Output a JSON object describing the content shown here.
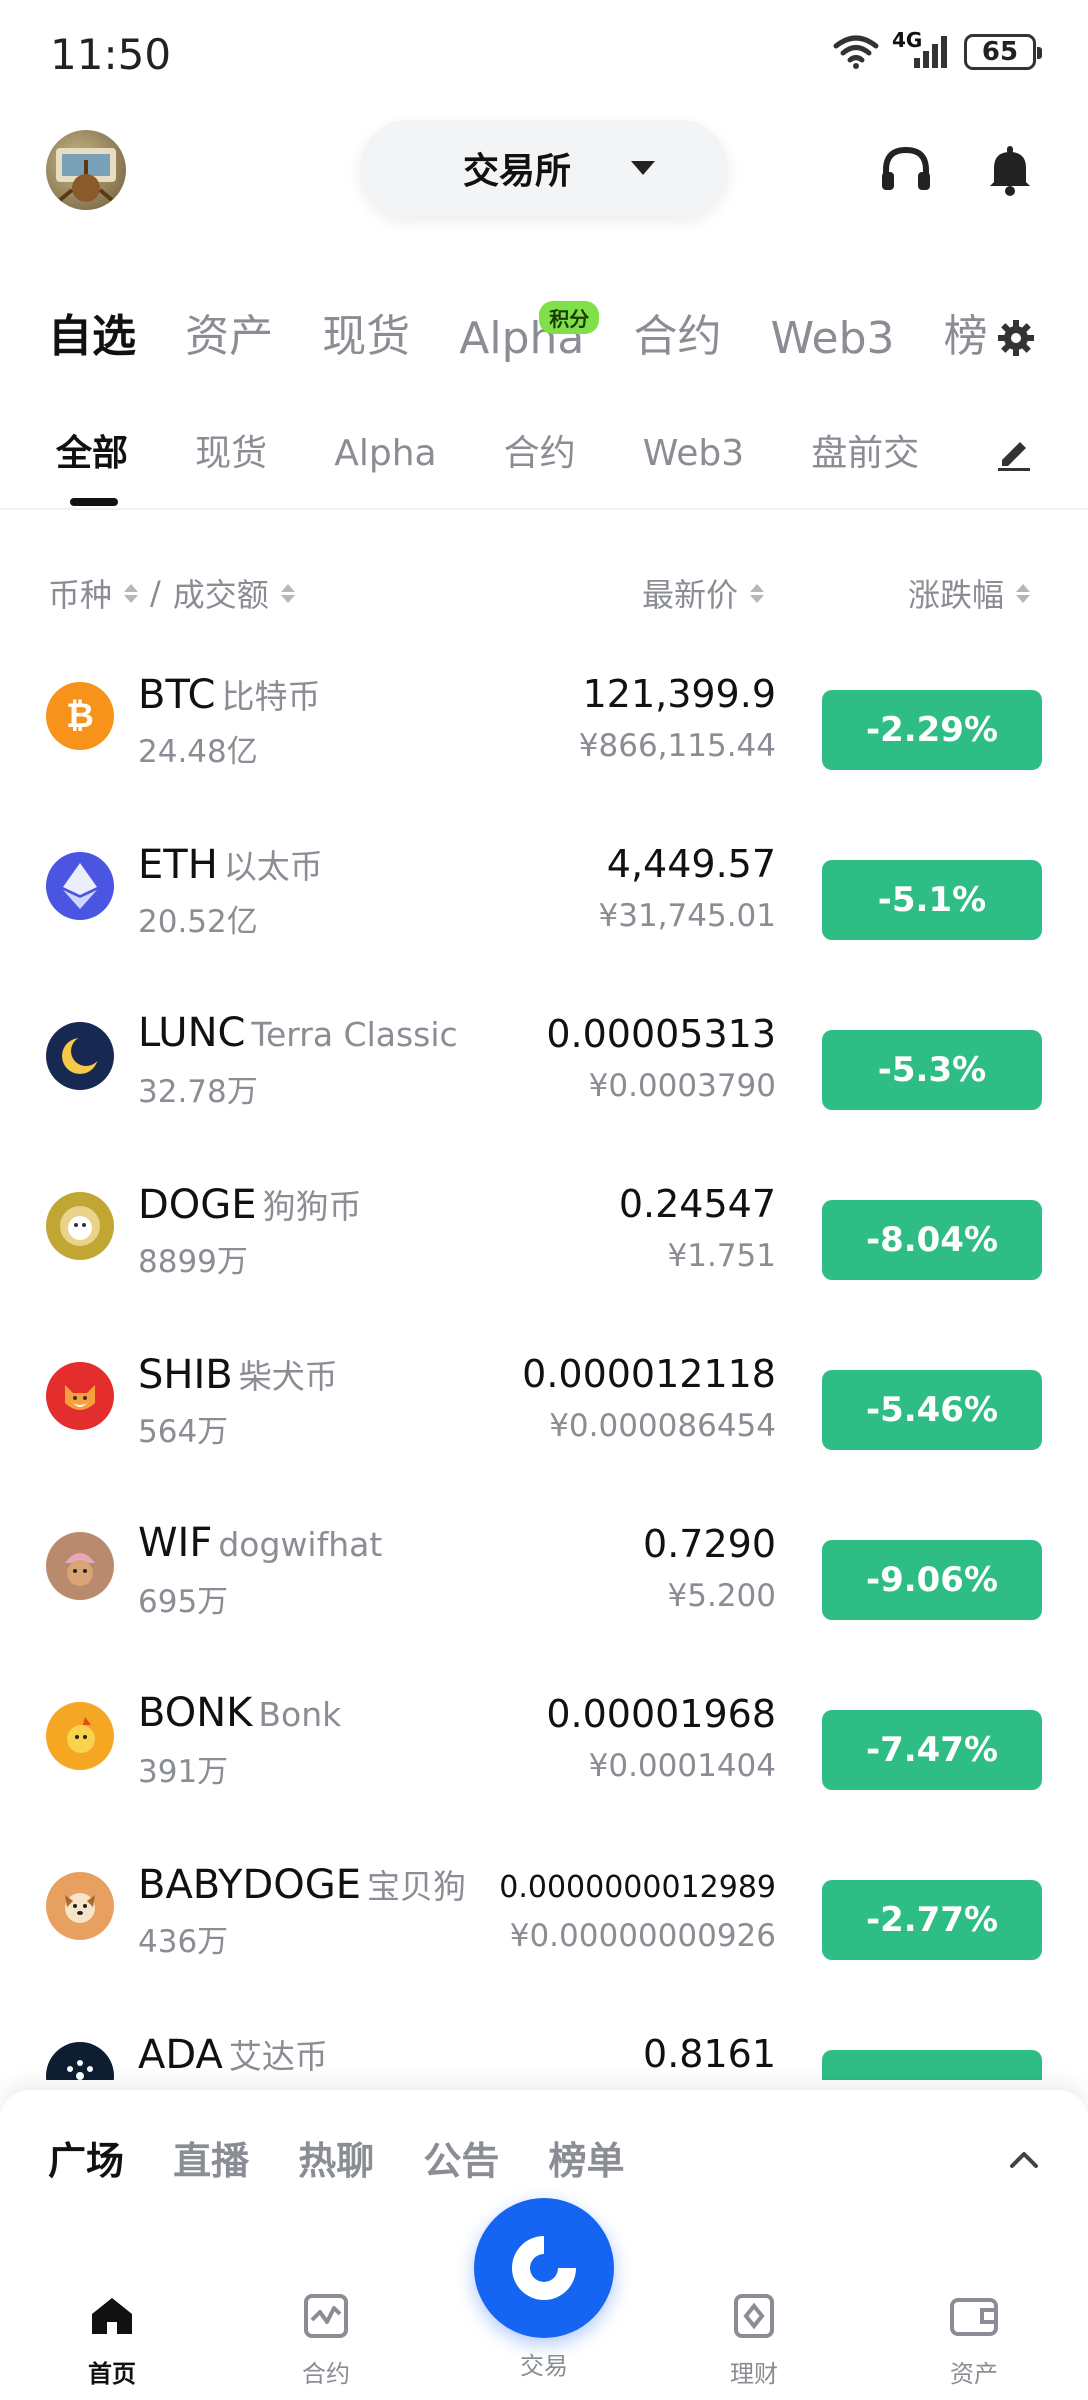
{
  "status_bar": {
    "time": "11:50",
    "network": "4G",
    "battery": "65"
  },
  "header": {
    "exchange_label": "交易所"
  },
  "category_tabs": {
    "items": [
      "自选",
      "资产",
      "现货",
      "Alpha",
      "合约",
      "Web3",
      "榜"
    ],
    "active_index": 0,
    "alpha_badge": "积分"
  },
  "sub_tabs": {
    "items": [
      "全部",
      "现货",
      "Alpha",
      "合约",
      "Web3",
      "盘前交"
    ],
    "active_index": 0
  },
  "table_header": {
    "coin": "币种",
    "separator": "/",
    "volume": "成交额",
    "price": "最新价",
    "change": "涨跌幅"
  },
  "rows": [
    {
      "symbol": "BTC",
      "name": "比特币",
      "volume": "24.48亿",
      "price": "121,399.9",
      "price_cny": "¥866,115.44",
      "change": "-2.29%",
      "icon": "bitcoin-icon",
      "icon_color": "#f7931a"
    },
    {
      "symbol": "ETH",
      "name": "以太币",
      "volume": "20.52亿",
      "price": "4,449.57",
      "price_cny": "¥31,745.01",
      "change": "-5.1%",
      "icon": "ethereum-icon",
      "icon_color": "#4a56e2"
    },
    {
      "symbol": "LUNC",
      "name": "Terra Classic",
      "volume": "32.78万",
      "price": "0.00005313",
      "price_cny": "¥0.0003790",
      "change": "-5.3%",
      "icon": "terra-icon",
      "icon_color": "#172852"
    },
    {
      "symbol": "DOGE",
      "name": "狗狗币",
      "volume": "8899万",
      "price": "0.24547",
      "price_cny": "¥1.751",
      "change": "-8.04%",
      "icon": "dogecoin-icon",
      "icon_color": "#c2a633"
    },
    {
      "symbol": "SHIB",
      "name": "柴犬币",
      "volume": "564万",
      "price": "0.000012118",
      "price_cny": "¥0.000086454",
      "change": "-5.46%",
      "icon": "shiba-icon",
      "icon_color": "#e42d2d"
    },
    {
      "symbol": "WIF",
      "name": "dogwifhat",
      "volume": "695万",
      "price": "0.7290",
      "price_cny": "¥5.200",
      "change": "-9.06%",
      "icon": "dogwifhat-icon",
      "icon_color": "#b98a6e"
    },
    {
      "symbol": "BONK",
      "name": "Bonk",
      "volume": "391万",
      "price": "0.00001968",
      "price_cny": "¥0.0001404",
      "change": "-7.47%",
      "icon": "bonk-icon",
      "icon_color": "#f5a623"
    },
    {
      "symbol": "BABYDOGE",
      "name": "宝贝狗",
      "volume": "436万",
      "price": "0.0000000012989",
      "price_cny": "¥0.00000000926",
      "change": "-2.77%",
      "icon": "babydoge-icon",
      "icon_color": "#e8a060"
    },
    {
      "symbol": "ADA",
      "name": "艾达币",
      "volume": "",
      "price": "0.8161",
      "price_cny": "",
      "change": "",
      "icon": "cardano-icon",
      "icon_color": "#0d1e30"
    }
  ],
  "feed_tabs": {
    "items": [
      "广场",
      "直播",
      "热聊",
      "公告",
      "榜单"
    ],
    "active_index": 0
  },
  "bottom_nav": {
    "items": [
      "首页",
      "合约",
      "交易",
      "理财",
      "资产"
    ],
    "active_index": 0
  },
  "colors": {
    "up_down_green": "#2ebd85",
    "accent_blue": "#1565f2",
    "badge_green": "#7fe04a"
  }
}
